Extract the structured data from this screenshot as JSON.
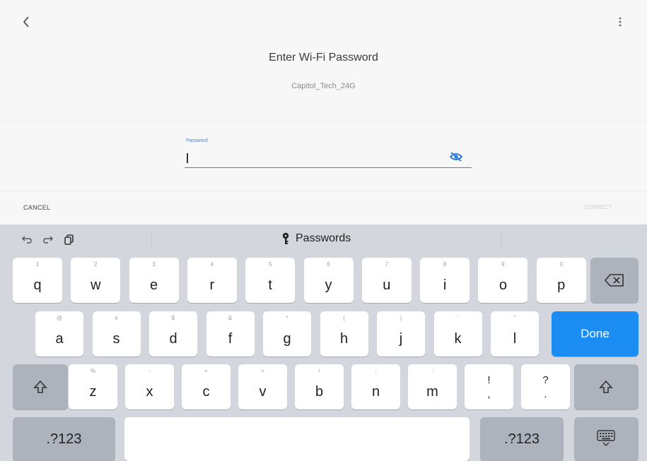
{
  "app": {
    "title": "Enter Wi-Fi Password",
    "network_name": "Capitol_Tech_24G",
    "password": {
      "label": "Password",
      "value": ""
    },
    "cancel_label": "CANCEL",
    "connect_label": "CONNECT",
    "icons": {
      "back": "chevron-left-icon",
      "more": "more-vert-icon",
      "visibility": "eye-icon"
    },
    "accent_color": "#3a82d6"
  },
  "keyboard": {
    "suggestion": {
      "label": "Passwords",
      "icon": "key-icon"
    },
    "toolbar_icons": [
      "undo-icon",
      "redo-icon",
      "paste-icon"
    ],
    "rows": [
      [
        {
          "k": "q",
          "h": "1"
        },
        {
          "k": "w",
          "h": "2"
        },
        {
          "k": "e",
          "h": "3"
        },
        {
          "k": "r",
          "h": "4"
        },
        {
          "k": "t",
          "h": "5"
        },
        {
          "k": "y",
          "h": "6"
        },
        {
          "k": "u",
          "h": "7"
        },
        {
          "k": "i",
          "h": "8"
        },
        {
          "k": "o",
          "h": "9"
        },
        {
          "k": "p",
          "h": "0"
        }
      ],
      [
        {
          "k": "a",
          "h": "@"
        },
        {
          "k": "s",
          "h": "#"
        },
        {
          "k": "d",
          "h": "$"
        },
        {
          "k": "f",
          "h": "&"
        },
        {
          "k": "g",
          "h": "*"
        },
        {
          "k": "h",
          "h": "("
        },
        {
          "k": "j",
          "h": ")"
        },
        {
          "k": "k",
          "h": "'"
        },
        {
          "k": "l",
          "h": "\""
        }
      ],
      [
        {
          "k": "z",
          "h": "%"
        },
        {
          "k": "x",
          "h": "-"
        },
        {
          "k": "c",
          "h": "+"
        },
        {
          "k": "v",
          "h": "="
        },
        {
          "k": "b",
          "h": "/"
        },
        {
          "k": "n",
          "h": ";"
        },
        {
          "k": "m",
          "h": ":"
        },
        {
          "k": "!\n,",
          "h": ""
        },
        {
          "k": "?\n.",
          "h": ""
        }
      ]
    ],
    "done_label": "Done",
    "numbers_label": ".?123",
    "done_color": "#1a8cf2"
  }
}
